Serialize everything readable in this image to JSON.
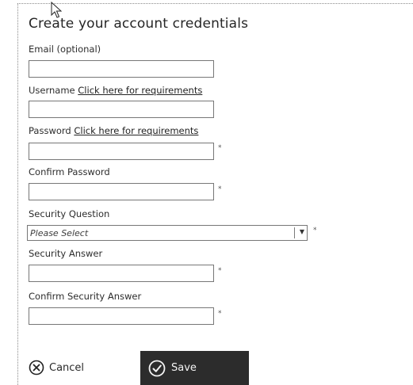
{
  "form": {
    "title": "Create your account credentials",
    "fields": {
      "email": {
        "label": "Email (optional)",
        "value": ""
      },
      "username": {
        "label": "Username",
        "link": "Click here for requirements",
        "value": ""
      },
      "password": {
        "label": "Password",
        "link": "Click here for requirements",
        "value": "",
        "required_marker": "*"
      },
      "confirm_password": {
        "label": "Confirm Password",
        "value": "",
        "required_marker": "*"
      },
      "security_question": {
        "label": "Security Question",
        "selected": "Please Select",
        "required_marker": "*"
      },
      "security_answer": {
        "label": "Security Answer",
        "value": "",
        "required_marker": "*"
      },
      "confirm_security_answer": {
        "label": "Confirm Security Answer",
        "value": "",
        "required_marker": "*"
      }
    },
    "buttons": {
      "cancel_label": "Cancel",
      "save_label": "Save"
    }
  },
  "icons": {
    "cursor": "mouse-pointer-icon",
    "cancel": "circle-x-icon",
    "save": "circle-check-icon",
    "dropdown": "chevron-down-icon"
  },
  "colors": {
    "save_background": "#2c2c2c",
    "save_text": "#f4f4f4",
    "border": "#777777"
  }
}
